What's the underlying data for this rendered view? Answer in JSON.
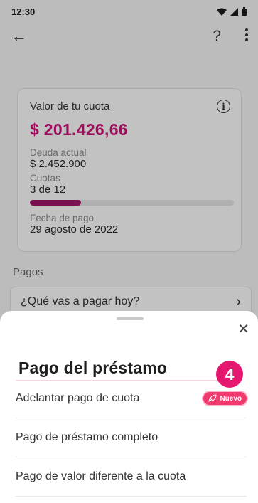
{
  "status_bar": {
    "time": "12:30"
  },
  "card": {
    "title": "Valor de tu cuota",
    "amount": "$ 201.426,66",
    "debt_label": "Deuda actual",
    "debt_value": "$ 2.452.900",
    "installments_label": "Cuotas",
    "installments_value": "3 de 12",
    "installments_progress": 0.25,
    "date_label": "Fecha de pago",
    "date_value": "29 agosto de 2022"
  },
  "payments": {
    "section_label": "Pagos",
    "prompt": "¿Qué vas a pagar hoy?"
  },
  "sheet": {
    "title": "Pago del préstamo",
    "step_number": "4",
    "options": [
      {
        "label": "Adelantar pago de cuota",
        "badge": "Nuevo"
      },
      {
        "label": "Pago de préstamo completo"
      },
      {
        "label": "Pago de valor diferente a la cuota"
      }
    ]
  },
  "colors": {
    "brand": "#d11079",
    "badge": "#f03a6e",
    "step": "#e5186f"
  }
}
